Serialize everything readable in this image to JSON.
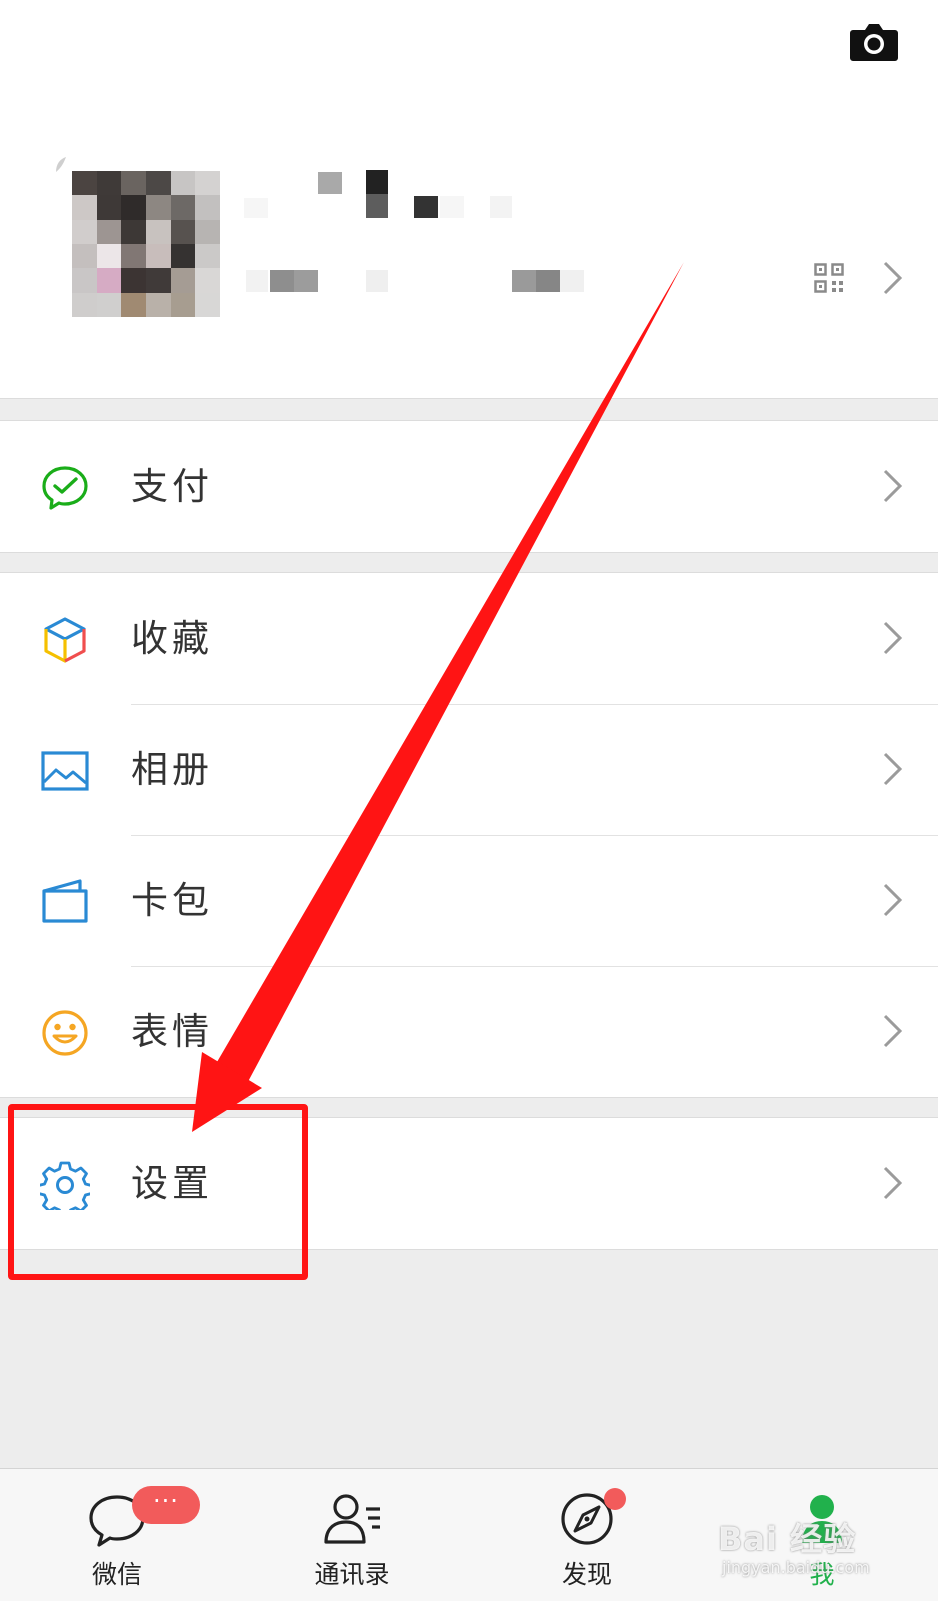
{
  "header": {
    "camera_icon": "camera-icon"
  },
  "profile": {
    "qr_icon": "qr-code-icon",
    "arrow_icon": "chevron-right-icon"
  },
  "menu": {
    "pay": {
      "label": "支付",
      "icon": "wechat-pay-icon",
      "color": "#1aad19"
    },
    "favorites": {
      "label": "收藏",
      "icon": "cube-favorites-icon"
    },
    "album": {
      "label": "相册",
      "icon": "photo-album-icon",
      "color": "#2a8ad4"
    },
    "cards": {
      "label": "卡包",
      "icon": "card-wallet-icon",
      "color": "#2a8ad4"
    },
    "stickers": {
      "label": "表情",
      "icon": "smiley-icon",
      "color": "#f5a623"
    },
    "settings": {
      "label": "设置",
      "icon": "gear-icon",
      "color": "#2a8ad4"
    }
  },
  "tabs": [
    {
      "label": "微信",
      "icon": "chat-bubble-icon",
      "badge": "···"
    },
    {
      "label": "通讯录",
      "icon": "contacts-icon"
    },
    {
      "label": "发现",
      "icon": "compass-icon"
    },
    {
      "label": "我",
      "icon": "me-person-icon",
      "active": true
    }
  ],
  "watermark": {
    "main": "Bai 经验",
    "sub": "jingyan.baidu.com"
  },
  "colors": {
    "accent_green": "#21b14c",
    "annotation_red": "#ff1414",
    "badge_red": "#f25b5b"
  }
}
